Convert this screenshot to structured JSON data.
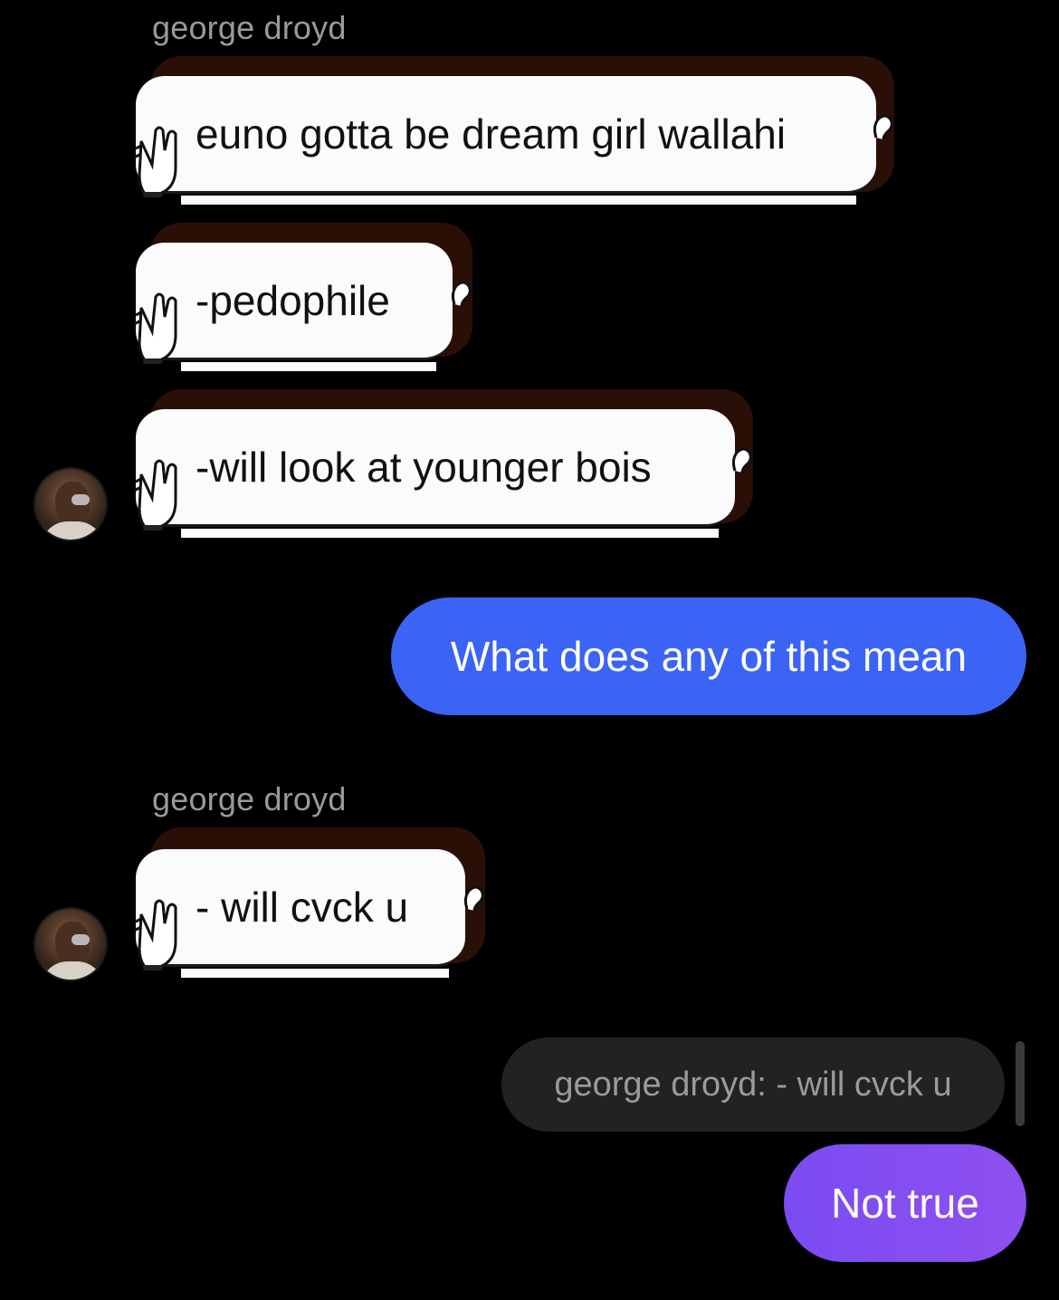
{
  "conversation": {
    "sender_name_1": "george droyd",
    "sender_name_2": "george droyd",
    "incoming_1": "euno gotta be dream girl wallahi",
    "incoming_2": "-pedophile",
    "incoming_3": "-will look at younger bois",
    "outgoing_1": "What does any of this mean",
    "incoming_4": "- will cvck u",
    "reply_quote": "george droyd: - will cvck u",
    "outgoing_2": "Not true"
  },
  "colors": {
    "background": "#000000",
    "incoming_bubble": "#fbfbfb",
    "outgoing_blue": "#3b63f5",
    "outgoing_gradient_start": "#7b4cf2",
    "outgoing_gradient_end": "#8e4ff0",
    "reply_quote_bg": "#222222",
    "sender_name": "#9a9a9a"
  },
  "icons": {
    "hand": "waving-hand-icon",
    "ear": "ear-icon",
    "avatar": "avatar"
  }
}
